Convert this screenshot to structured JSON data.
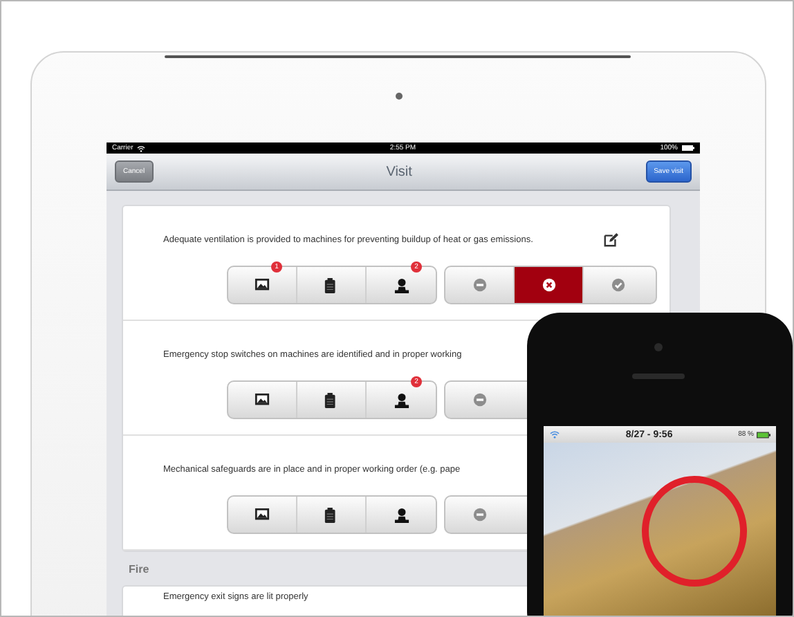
{
  "status_bar": {
    "carrier": "Carrier",
    "time": "2:55 PM",
    "battery": "100%"
  },
  "nav": {
    "left_button": "Cancel",
    "title": "Visit",
    "right_button": "Save visit"
  },
  "items": [
    {
      "text": "Adequate ventilation is provided to machines for preventing  buildup of heat or gas emissions.",
      "editable": true,
      "attachments": [
        {
          "kind": "photo",
          "badge": "1"
        },
        {
          "kind": "clipboard"
        },
        {
          "kind": "person",
          "badge": "2"
        }
      ],
      "answers": [
        {
          "kind": "minus",
          "selected": false
        },
        {
          "kind": "cross",
          "selected": true
        },
        {
          "kind": "check",
          "selected": false
        }
      ]
    },
    {
      "text": "Emergency stop switches on machines are identified and in  proper working",
      "attachments": [
        {
          "kind": "photo"
        },
        {
          "kind": "clipboard"
        },
        {
          "kind": "person",
          "badge": "2"
        }
      ],
      "answers": [
        {
          "kind": "minus",
          "selected": false
        }
      ]
    },
    {
      "text": "Mechanical safeguards are in place and in proper working  order (e.g. pape",
      "attachments": [
        {
          "kind": "photo"
        },
        {
          "kind": "clipboard"
        },
        {
          "kind": "person"
        }
      ],
      "answers": [
        {
          "kind": "minus",
          "selected": false
        }
      ]
    }
  ],
  "section": {
    "title": "Fire",
    "first_item": "Emergency exit signs are lit properly"
  },
  "phone": {
    "time": "8/27 - 9:56",
    "battery": "88 %"
  }
}
